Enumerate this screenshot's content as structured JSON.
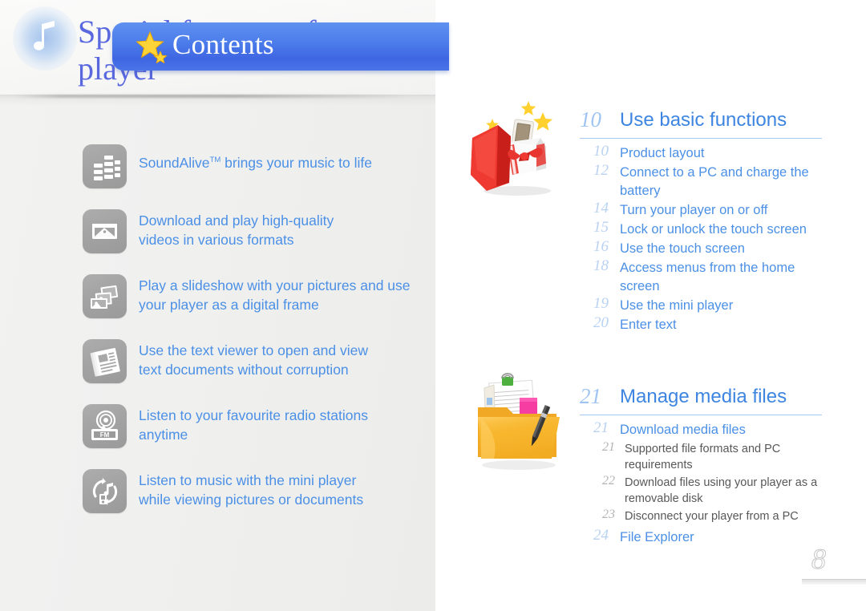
{
  "left": {
    "badge_icon": "music-note-icon",
    "title": "Special features of your player",
    "features": [
      {
        "icon": "equalizer-icon",
        "lines": [
          "SoundAlive",
          "TM",
          " brings your music to life"
        ],
        "text_plain": "SoundAliveTM brings your music to life",
        "line1": "SoundAlive",
        "sup": "TM",
        "line1_rest": " brings your music to life",
        "line2": ""
      },
      {
        "icon": "video-player-icon",
        "line1": "Download and play high-quality",
        "line2": "videos in various formats"
      },
      {
        "icon": "slideshow-frames-icon",
        "line1": "Play a slideshow with your pictures and use",
        "line2": "your player as a digital frame"
      },
      {
        "icon": "text-viewer-icon",
        "line1": "Use the text viewer to open and view",
        "line2": "text documents without corruption"
      },
      {
        "icon": "fm-radio-icon",
        "line1": "Listen to your favourite radio stations",
        "line2": "anytime"
      },
      {
        "icon": "mini-player-icon",
        "line1": "Listen to music with the mini player",
        "line2": "while viewing pictures or documents"
      }
    ]
  },
  "right": {
    "banner": {
      "label": "Contents",
      "icon": "star-icon"
    },
    "illustrations": [
      {
        "name": "gift-box-illustration"
      },
      {
        "name": "folder-documents-illustration"
      }
    ],
    "sections": [
      {
        "number": "10",
        "title": "Use basic functions",
        "items": [
          {
            "number": "10",
            "label": "Product layout",
            "level": 1
          },
          {
            "number": "12",
            "label": "Connect to a PC and charge the battery",
            "level": 1
          },
          {
            "number": "14",
            "label": "Turn your player on or off",
            "level": 1
          },
          {
            "number": "15",
            "label": "Lock or unlock the touch screen",
            "level": 1
          },
          {
            "number": "16",
            "label": "Use the touch screen",
            "level": 1
          },
          {
            "number": "18",
            "label": "Access menus from the home screen",
            "level": 1
          },
          {
            "number": "19",
            "label": "Use the mini player",
            "level": 1
          },
          {
            "number": "20",
            "label": "Enter text",
            "level": 1
          }
        ]
      },
      {
        "number": "21",
        "title": "Manage media files",
        "items": [
          {
            "number": "21",
            "label": "Download media files",
            "level": 1
          },
          {
            "number": "21",
            "label": "Supported file formats and PC requirements",
            "level": 2
          },
          {
            "number": "22",
            "label": "Download files using your player as a removable disk",
            "level": 2
          },
          {
            "number": "23",
            "label": "Disconnect your player from a PC",
            "level": 2
          },
          {
            "number": "24",
            "label": "File Explorer",
            "level": 1
          }
        ]
      }
    ],
    "page_number": "8"
  },
  "colors": {
    "title_blue": "#5a68e0",
    "body_blue": "#4b90e6",
    "heading_blue": "#3d85e0",
    "banner_blue": "#4a7bea",
    "number_blue": "#b9d2f1",
    "sub_gray": "#585858",
    "icon_tile_gray": "#a3a3a3",
    "star_yellow": "#ffcc33"
  }
}
